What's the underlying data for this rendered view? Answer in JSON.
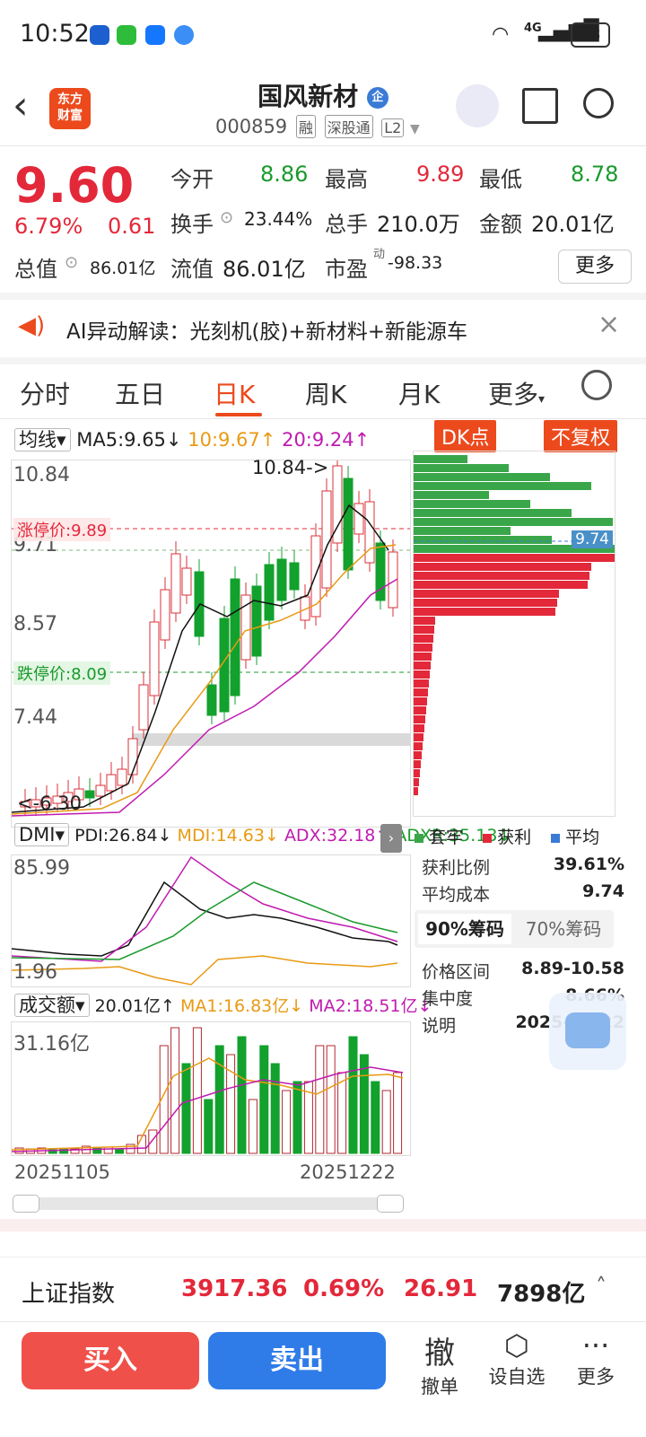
{
  "status_bar": {
    "time": "10:52",
    "battery": "78",
    "network": "4G"
  },
  "header": {
    "logo": "东方\n财富",
    "title": "国风新材",
    "title_tag": "企",
    "code": "000859",
    "tags": [
      "融",
      "深股通",
      "L2"
    ]
  },
  "quote": {
    "price": "9.60",
    "change_pct": "6.79%",
    "change": "0.61",
    "open_label": "今开",
    "open": "8.86",
    "high_label": "最高",
    "high": "9.89",
    "low_label": "最低",
    "low": "8.78",
    "turnover_label": "换手",
    "turnover": "23.44%",
    "volume_label": "总手",
    "volume": "210.0万",
    "amount_label": "金额",
    "amount": "20.01亿",
    "mktcap_label": "总值",
    "mktcap": "86.01亿",
    "float_label": "流值",
    "float": "86.01亿",
    "pe_label": "市盈",
    "pe_sup": "动",
    "pe": "-98.33",
    "more": "更多"
  },
  "ai_bar": {
    "text": "AI异动解读：光刻机(胶)+新材料+新能源车"
  },
  "tabs": [
    "分时",
    "五日",
    "日K",
    "周K",
    "月K",
    "更多"
  ],
  "chart": {
    "indicator_select": "均线",
    "ma5": "MA5:9.65",
    "ma10": "10:9.67",
    "ma20": "20:9.24",
    "dk_badge": "DK点",
    "adjust_badge": "不复权",
    "y_labels": [
      "10.84",
      "9.71",
      "8.57",
      "7.44"
    ],
    "limit_up": "涨停价:9.89",
    "limit_down": "跌停价:8.09",
    "max_label": "10.84->",
    "min_label": "<-6.30",
    "chip_price": "9.74",
    "dmi_select": "DMI",
    "pdi": "PDI:26.84",
    "mdi": "MDI:14.63",
    "adx": "ADX:32.18",
    "adxr": "ADXR:35.13",
    "dmi_max": "85.99",
    "dmi_min": "1.96",
    "vol_select": "成交额",
    "vol_now": "20.01亿",
    "vol_ma1": "MA1:16.83亿",
    "vol_ma2": "MA2:18.51亿",
    "vol_max": "31.16亿",
    "date_start": "20251105",
    "date_end": "20251222"
  },
  "chips": {
    "legend": [
      "套牢",
      "获利",
      "平均"
    ],
    "rows": [
      {
        "label": "获利比例",
        "value": "39.61%"
      },
      {
        "label": "平均成本",
        "value": "9.74"
      }
    ],
    "tab_90": "90%筹码",
    "tab_70": "70%筹码",
    "rows2": [
      {
        "label": "价格区间",
        "value": "8.89-10.58"
      },
      {
        "label": "集中度",
        "value": "8.66%"
      },
      {
        "label": "说明",
        "value": "2025-12-22"
      }
    ]
  },
  "index_bar": {
    "name": "上证指数",
    "value": "3917.36",
    "pct": "0.69%",
    "change": "26.91",
    "amount": "7898亿"
  },
  "bottom": {
    "buy": "买入",
    "sell": "卖出",
    "cancel_icon": "撤",
    "cancel": "撤单",
    "watch": "设自选",
    "more": "更多"
  }
}
